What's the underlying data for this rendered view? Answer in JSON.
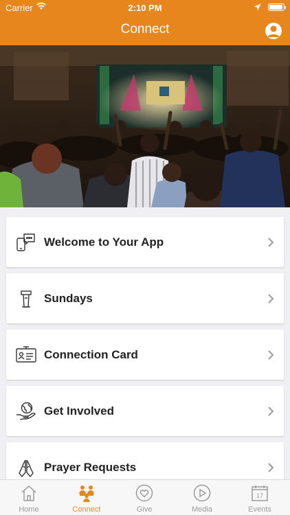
{
  "status": {
    "carrier": "Carrier",
    "time": "2:10 PM"
  },
  "nav": {
    "title": "Connect"
  },
  "list": {
    "items": [
      {
        "label": "Welcome to Your App",
        "icon": "chat-phone-icon"
      },
      {
        "label": "Sundays",
        "icon": "pulpit-icon"
      },
      {
        "label": "Connection Card",
        "icon": "id-card-icon"
      },
      {
        "label": "Get Involved",
        "icon": "globe-hand-icon"
      },
      {
        "label": "Prayer Requests",
        "icon": "praying-hands-icon"
      }
    ]
  },
  "tabs": [
    {
      "label": "Home",
      "icon": "home-icon",
      "active": false
    },
    {
      "label": "Connect",
      "icon": "connect-people-icon",
      "active": true
    },
    {
      "label": "Give",
      "icon": "heart-icon",
      "active": false
    },
    {
      "label": "Media",
      "icon": "play-icon",
      "active": false
    },
    {
      "label": "Events",
      "icon": "calendar-icon",
      "active": false,
      "badge": "17"
    }
  ],
  "colors": {
    "accent": "#e8861e",
    "tab_inactive": "#9b9b9b",
    "background": "#efeff4"
  }
}
